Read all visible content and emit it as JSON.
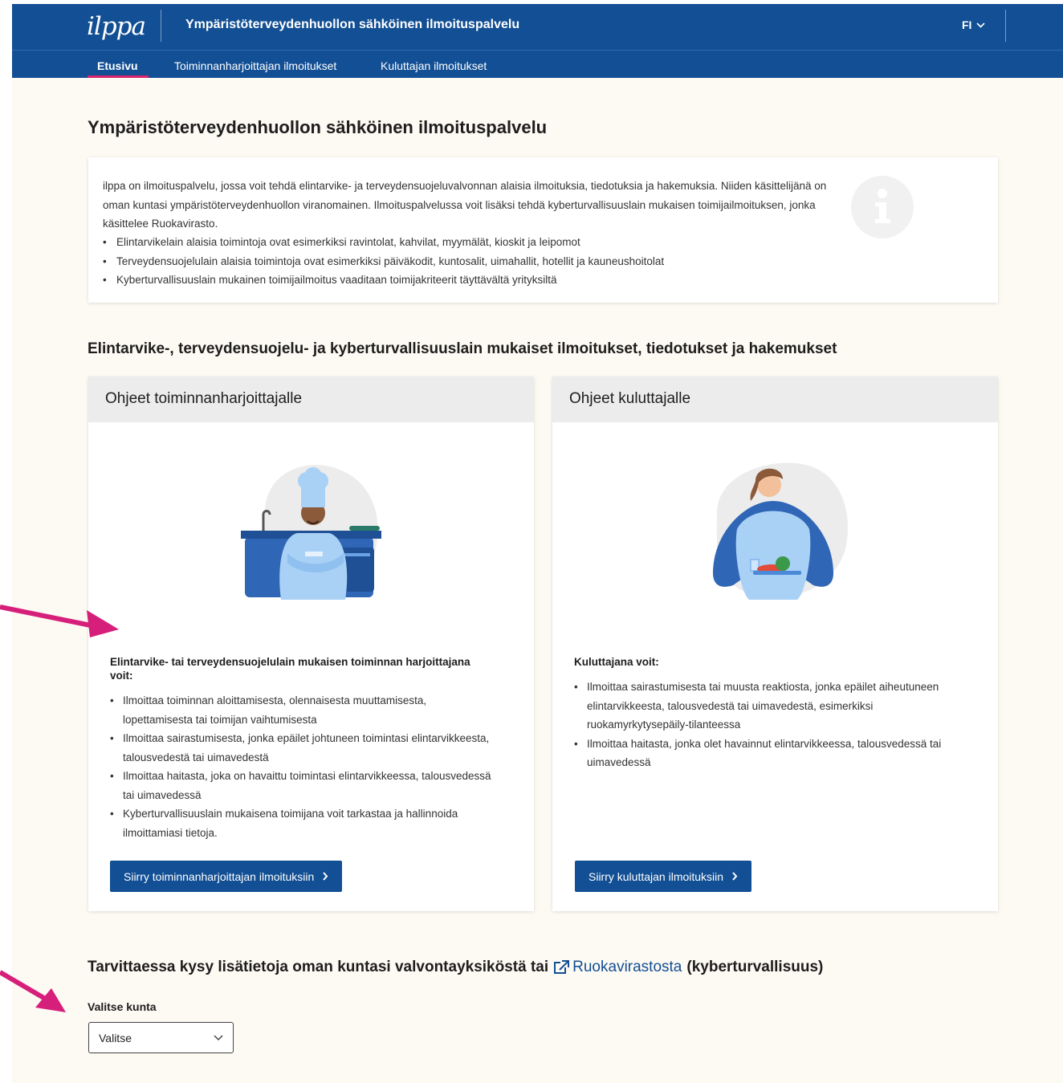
{
  "header": {
    "logo": "ilppa",
    "title": "Ympäristöterveydenhuollon sähköinen ilmoituspalvelu",
    "language": "FI"
  },
  "nav": {
    "items": [
      {
        "label": "Etusivu",
        "active": true
      },
      {
        "label": "Toiminnanharjoittajan ilmoitukset",
        "active": false
      },
      {
        "label": "Kuluttajan ilmoitukset",
        "active": false
      }
    ]
  },
  "main": {
    "title": "Ympäristöterveydenhuollon sähköinen ilmoituspalvelu",
    "info": {
      "text": "ilppa on ilmoituspalvelu, jossa voit tehdä elintarvike- ja terveydensuojeluvalvonnan alaisia ilmoituksia, tiedotuksia ja hakemuksia. Niiden käsittelijänä on oman kuntasi ympäristöterveydenhuollon viranomainen. Ilmoituspalvelussa voit lisäksi tehdä kyberturvallisuuslain mukaisen toimijailmoituksen, jonka käsittelee Ruokavirasto.",
      "bullets": [
        "Elintarvikelain alaisia toimintoja ovat esimerkiksi ravintolat, kahvilat, myymälät, kioskit ja leipomot",
        "Terveydensuojelulain alaisia toimintoja ovat esimerkiksi päiväkodit, kuntosalit, uimahallit, hotellit ja kauneushoitolat",
        "Kyberturvallisuuslain mukainen toimijailmoitus vaaditaan toimijakriteerit täyttävältä yrityksiltä"
      ],
      "icon": "info-icon"
    },
    "section_title": "Elintarvike-, terveydensuojelu- ja kyberturvallisuuslain mukaiset ilmoitukset, tiedotukset ja hakemukset",
    "operator_card": {
      "title": "Ohjeet toiminnanharjoittajalle",
      "lead": "Elintarvike- tai terveydensuojelulain mukaisen toiminnan harjoittajana voit:",
      "bullets": [
        "Ilmoittaa toiminnan aloittamisesta, olennaisesta muuttamisesta, lopettamisesta tai toimijan vaihtumisesta",
        "Ilmoittaa sairastumisesta, jonka epäilet johtuneen toimintasi elintarvikkeesta, talousvedestä tai uimavedestä",
        "Ilmoittaa haitasta, joka on havaittu toimintasi elintarvikkeessa, talousvedessä tai uimavedessä",
        "Kyberturvallisuuslain mukaisena toimijana voit tarkastaa ja hallinnoida ilmoittamiasi tietoja."
      ],
      "button": "Siirry toiminnanharjoittajan ilmoituksiin"
    },
    "consumer_card": {
      "title": "Ohjeet kuluttajalle",
      "lead": "Kuluttajana voit:",
      "bullets": [
        "Ilmoittaa sairastumisesta tai muusta reaktiosta, jonka epäilet aiheutuneen elintarvikkeesta, talousvedestä tai uimavedestä, esimerkiksi ruokamyrkytysepäily-tilanteessa",
        "Ilmoittaa haitasta, jonka olet havainnut elintarvikkeessa, talousvedessä tai uimavedessä"
      ],
      "button": "Siirry kuluttajan ilmoituksiin"
    },
    "contact": {
      "text_before": "Tarvittaessa kysy lisätietoja oman kuntasi valvontayksiköstä tai",
      "link": "Ruokavirastosta",
      "text_after": "(kyberturvallisuus)"
    },
    "municipality": {
      "label": "Valitse kunta",
      "value": "Valitse"
    }
  },
  "colors": {
    "brand": "#124f94",
    "accent": "#d9256f",
    "background": "#fdf9f3"
  }
}
